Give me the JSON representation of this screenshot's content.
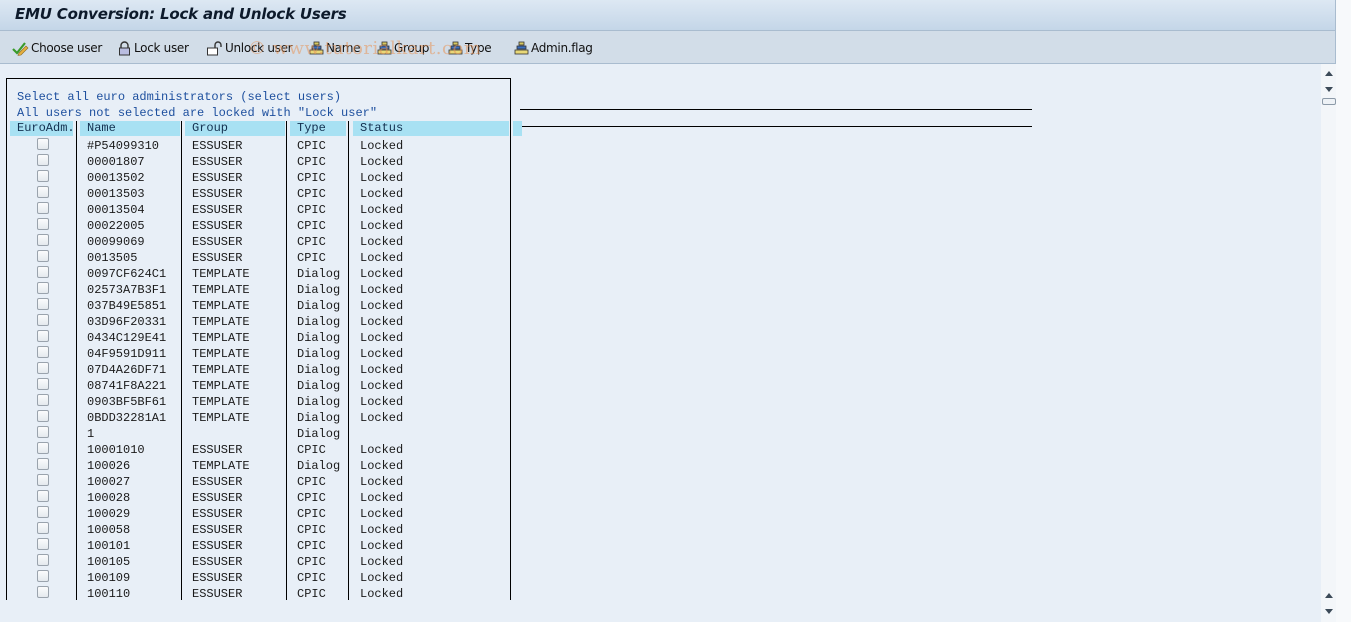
{
  "window": {
    "title": "EMU Conversion: Lock and Unlock Users"
  },
  "toolbar": {
    "buttons": [
      {
        "label": "Choose user",
        "icon": "check-pencil-icon"
      },
      {
        "label": "Lock user",
        "icon": "lock-closed-icon"
      },
      {
        "label": "Unlock user",
        "icon": "lock-open-icon"
      },
      {
        "label": "Name",
        "icon": "sort-icon"
      },
      {
        "label": "Group",
        "icon": "sort-icon"
      },
      {
        "label": "Type",
        "icon": "sort-icon"
      },
      {
        "label": "Admin.flag",
        "icon": "sort-icon"
      }
    ]
  },
  "watermark": "© www.tutorialkart.com",
  "list": {
    "info_lines": [
      "Select all euro administrators (select users)",
      "All users not selected are locked with \"Lock user\""
    ],
    "columns": [
      "EuroAdm.",
      "Name",
      "Group",
      "Type",
      "Status"
    ],
    "rows": [
      {
        "euro_adm": false,
        "name": "#P54099310",
        "group": "ESSUSER",
        "type": "CPIC",
        "status": "Locked"
      },
      {
        "euro_adm": false,
        "name": "00001807",
        "group": "ESSUSER",
        "type": "CPIC",
        "status": "Locked"
      },
      {
        "euro_adm": false,
        "name": "00013502",
        "group": "ESSUSER",
        "type": "CPIC",
        "status": "Locked"
      },
      {
        "euro_adm": false,
        "name": "00013503",
        "group": "ESSUSER",
        "type": "CPIC",
        "status": "Locked"
      },
      {
        "euro_adm": false,
        "name": "00013504",
        "group": "ESSUSER",
        "type": "CPIC",
        "status": "Locked"
      },
      {
        "euro_adm": false,
        "name": "00022005",
        "group": "ESSUSER",
        "type": "CPIC",
        "status": "Locked"
      },
      {
        "euro_adm": false,
        "name": "00099069",
        "group": "ESSUSER",
        "type": "CPIC",
        "status": "Locked"
      },
      {
        "euro_adm": false,
        "name": "0013505",
        "group": "ESSUSER",
        "type": "CPIC",
        "status": "Locked"
      },
      {
        "euro_adm": false,
        "name": "0097CF624C1",
        "group": "TEMPLATE",
        "type": "Dialog",
        "status": "Locked"
      },
      {
        "euro_adm": false,
        "name": "02573A7B3F1",
        "group": "TEMPLATE",
        "type": "Dialog",
        "status": "Locked"
      },
      {
        "euro_adm": false,
        "name": "037B49E5851",
        "group": "TEMPLATE",
        "type": "Dialog",
        "status": "Locked"
      },
      {
        "euro_adm": false,
        "name": "03D96F20331",
        "group": "TEMPLATE",
        "type": "Dialog",
        "status": "Locked"
      },
      {
        "euro_adm": false,
        "name": "0434C129E41",
        "group": "TEMPLATE",
        "type": "Dialog",
        "status": "Locked"
      },
      {
        "euro_adm": false,
        "name": "04F9591D911",
        "group": "TEMPLATE",
        "type": "Dialog",
        "status": "Locked"
      },
      {
        "euro_adm": false,
        "name": "07D4A26DF71",
        "group": "TEMPLATE",
        "type": "Dialog",
        "status": "Locked"
      },
      {
        "euro_adm": false,
        "name": "08741F8A221",
        "group": "TEMPLATE",
        "type": "Dialog",
        "status": "Locked"
      },
      {
        "euro_adm": false,
        "name": "0903BF5BF61",
        "group": "TEMPLATE",
        "type": "Dialog",
        "status": "Locked"
      },
      {
        "euro_adm": false,
        "name": "0BDD32281A1",
        "group": "TEMPLATE",
        "type": "Dialog",
        "status": "Locked"
      },
      {
        "euro_adm": false,
        "name": "1",
        "group": "",
        "type": "Dialog",
        "status": ""
      },
      {
        "euro_adm": false,
        "name": "10001010",
        "group": "ESSUSER",
        "type": "CPIC",
        "status": "Locked"
      },
      {
        "euro_adm": false,
        "name": "100026",
        "group": "TEMPLATE",
        "type": "Dialog",
        "status": "Locked"
      },
      {
        "euro_adm": false,
        "name": "100027",
        "group": "ESSUSER",
        "type": "CPIC",
        "status": "Locked"
      },
      {
        "euro_adm": false,
        "name": "100028",
        "group": "ESSUSER",
        "type": "CPIC",
        "status": "Locked"
      },
      {
        "euro_adm": false,
        "name": "100029",
        "group": "ESSUSER",
        "type": "CPIC",
        "status": "Locked"
      },
      {
        "euro_adm": false,
        "name": "100058",
        "group": "ESSUSER",
        "type": "CPIC",
        "status": "Locked"
      },
      {
        "euro_adm": false,
        "name": "100101",
        "group": "ESSUSER",
        "type": "CPIC",
        "status": "Locked"
      },
      {
        "euro_adm": false,
        "name": "100105",
        "group": "ESSUSER",
        "type": "CPIC",
        "status": "Locked"
      },
      {
        "euro_adm": false,
        "name": "100109",
        "group": "ESSUSER",
        "type": "CPIC",
        "status": "Locked"
      },
      {
        "euro_adm": false,
        "name": "100110",
        "group": "ESSUSER",
        "type": "CPIC",
        "status": "Locked"
      }
    ]
  },
  "colors": {
    "header_bg": "#a8e1f3",
    "info_text": "#1d4f9e",
    "background": "#e8eff7"
  }
}
